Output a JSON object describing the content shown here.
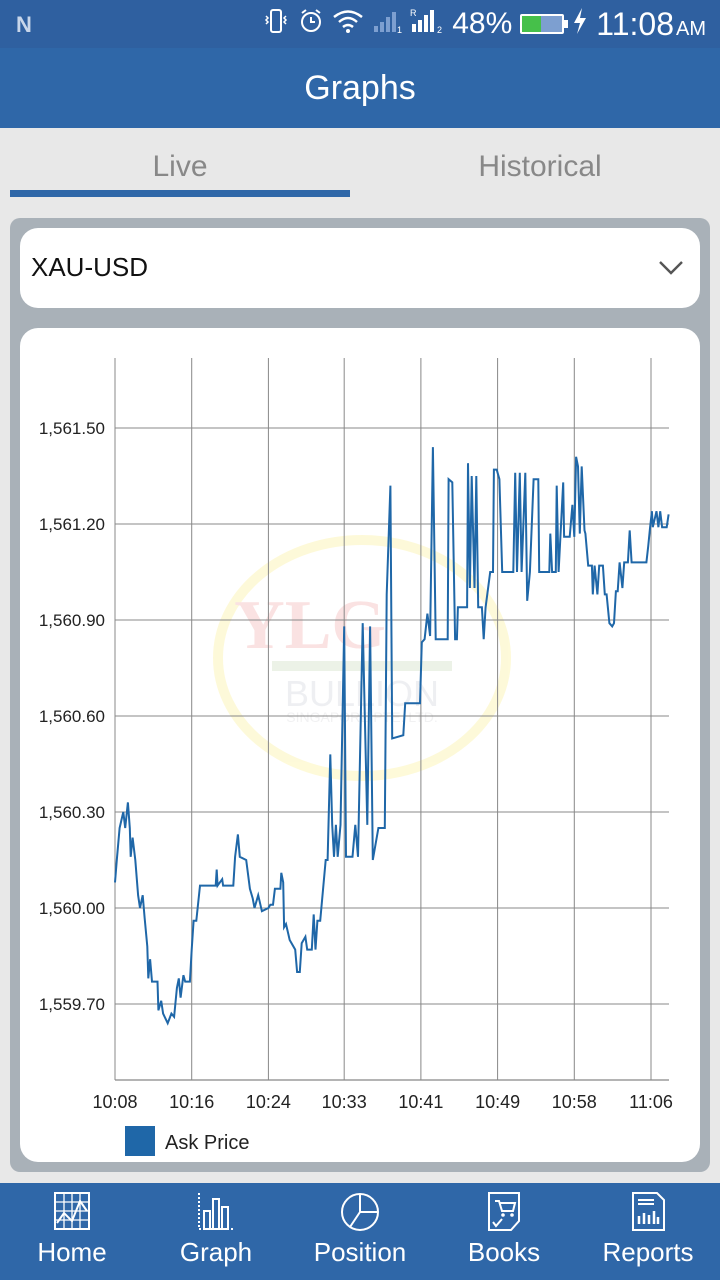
{
  "statusbar": {
    "notification_icon": "n-icon",
    "icons": [
      "vibrate-icon",
      "alarm-icon",
      "wifi-icon",
      "signal-sim1-icon",
      "signal-sim2-icon"
    ],
    "battery_percent": "48%",
    "battery_level": 0.48,
    "charging_icon": "lightning-icon",
    "time": "11:08",
    "ampm": "AM"
  },
  "appbar": {
    "title": "Graphs"
  },
  "tabs": [
    {
      "label": "Live",
      "active": true
    },
    {
      "label": "Historical",
      "active": false
    }
  ],
  "selector": {
    "value": "XAU-USD",
    "icon": "chevron-down-icon"
  },
  "watermark": {
    "line1": "YLG",
    "line2": "BULLION",
    "line3": "SINGAPORE PTE. LTD."
  },
  "colors": {
    "primary": "#2f67a8",
    "line": "#1f67a8",
    "grid": "#888888"
  },
  "chart_data": {
    "type": "line",
    "title": "",
    "xlabel": "",
    "ylabel": "",
    "x_unit": "minutes after 10:08",
    "xlim": [
      0,
      60
    ],
    "ylim": [
      1559.45,
      1561.72
    ],
    "yticks": [
      1559.7,
      1560.0,
      1560.3,
      1560.6,
      1560.9,
      1561.2,
      1561.5
    ],
    "ytick_labels": [
      "1,559.70",
      "1,560.00",
      "1,560.30",
      "1,560.60",
      "1,560.90",
      "1,561.20",
      "1,561.50"
    ],
    "xticks": [
      0,
      8.3,
      16.6,
      24.8,
      33.1,
      41.4,
      49.7,
      58
    ],
    "xtick_labels": [
      "10:08",
      "10:16",
      "10:24",
      "10:33",
      "10:41",
      "10:49",
      "10:58",
      "11:06"
    ],
    "grid": true,
    "legend": {
      "position": "bottom-left",
      "entries": [
        {
          "label": "Ask Price",
          "color": "#1f67a8"
        }
      ]
    },
    "series": [
      {
        "name": "Ask Price",
        "points": [
          [
            0.0,
            1560.08
          ],
          [
            0.2,
            1560.15
          ],
          [
            0.5,
            1560.25
          ],
          [
            0.9,
            1560.3
          ],
          [
            1.1,
            1560.25
          ],
          [
            1.4,
            1560.33
          ],
          [
            1.6,
            1560.25
          ],
          [
            1.7,
            1560.16
          ],
          [
            1.9,
            1560.22
          ],
          [
            2.2,
            1560.15
          ],
          [
            2.5,
            1560.04
          ],
          [
            2.7,
            1560.0
          ],
          [
            3.0,
            1560.04
          ],
          [
            3.2,
            1559.97
          ],
          [
            3.5,
            1559.88
          ],
          [
            3.6,
            1559.78
          ],
          [
            3.8,
            1559.84
          ],
          [
            4.0,
            1559.77
          ],
          [
            4.6,
            1559.77
          ],
          [
            4.7,
            1559.68
          ],
          [
            5.0,
            1559.71
          ],
          [
            5.2,
            1559.67
          ],
          [
            5.7,
            1559.64
          ],
          [
            6.1,
            1559.67
          ],
          [
            6.4,
            1559.66
          ],
          [
            6.7,
            1559.75
          ],
          [
            6.9,
            1559.78
          ],
          [
            7.1,
            1559.72
          ],
          [
            7.4,
            1559.79
          ],
          [
            7.6,
            1559.77
          ],
          [
            8.1,
            1559.77
          ],
          [
            8.3,
            1559.87
          ],
          [
            8.5,
            1559.96
          ],
          [
            8.8,
            1559.96
          ],
          [
            9.2,
            1560.07
          ],
          [
            10.9,
            1560.07
          ],
          [
            11.0,
            1560.12
          ],
          [
            11.1,
            1560.07
          ],
          [
            11.6,
            1560.09
          ],
          [
            11.7,
            1560.07
          ],
          [
            12.8,
            1560.07
          ],
          [
            13.0,
            1560.16
          ],
          [
            13.3,
            1560.23
          ],
          [
            13.5,
            1560.16
          ],
          [
            14.2,
            1560.15
          ],
          [
            14.6,
            1560.06
          ],
          [
            14.9,
            1560.03
          ],
          [
            15.1,
            1560.0
          ],
          [
            15.5,
            1560.04
          ],
          [
            15.9,
            1559.99
          ],
          [
            16.6,
            1560.0
          ],
          [
            16.8,
            1560.01
          ],
          [
            17.1,
            1560.01
          ],
          [
            17.3,
            1560.06
          ],
          [
            17.9,
            1560.06
          ],
          [
            18.0,
            1560.11
          ],
          [
            18.2,
            1560.08
          ],
          [
            18.3,
            1559.94
          ],
          [
            18.5,
            1559.95
          ],
          [
            18.9,
            1559.9
          ],
          [
            19.5,
            1559.87
          ],
          [
            19.7,
            1559.8
          ],
          [
            20.0,
            1559.8
          ],
          [
            20.2,
            1559.89
          ],
          [
            20.6,
            1559.91
          ],
          [
            20.8,
            1559.87
          ],
          [
            21.1,
            1559.87
          ],
          [
            21.3,
            1559.87
          ],
          [
            21.5,
            1559.98
          ],
          [
            21.7,
            1559.87
          ],
          [
            21.9,
            1559.96
          ],
          [
            22.2,
            1559.96
          ],
          [
            22.8,
            1560.15
          ],
          [
            23.0,
            1560.15
          ],
          [
            23.3,
            1560.48
          ],
          [
            23.5,
            1560.26
          ],
          [
            23.7,
            1560.16
          ],
          [
            23.9,
            1560.26
          ],
          [
            24.1,
            1560.16
          ],
          [
            24.4,
            1560.26
          ],
          [
            24.8,
            1560.88
          ],
          [
            25.0,
            1560.16
          ],
          [
            25.7,
            1560.16
          ],
          [
            26.0,
            1560.26
          ],
          [
            26.3,
            1560.16
          ],
          [
            26.8,
            1560.89
          ],
          [
            27.3,
            1560.26
          ],
          [
            27.6,
            1560.88
          ],
          [
            27.9,
            1560.15
          ],
          [
            28.5,
            1560.25
          ],
          [
            29.2,
            1560.25
          ],
          [
            29.4,
            1560.98
          ],
          [
            29.8,
            1561.32
          ],
          [
            30.0,
            1560.53
          ],
          [
            31.2,
            1560.54
          ],
          [
            31.4,
            1560.64
          ],
          [
            33.0,
            1560.64
          ],
          [
            33.2,
            1560.83
          ],
          [
            33.5,
            1560.84
          ],
          [
            33.8,
            1560.92
          ],
          [
            34.1,
            1560.85
          ],
          [
            34.4,
            1561.44
          ],
          [
            34.7,
            1560.84
          ],
          [
            36.0,
            1560.84
          ],
          [
            36.1,
            1561.34
          ],
          [
            36.5,
            1561.33
          ],
          [
            36.8,
            1560.84
          ],
          [
            37.0,
            1560.84
          ],
          [
            37.1,
            1560.94
          ],
          [
            38.1,
            1560.94
          ],
          [
            38.2,
            1561.39
          ],
          [
            38.4,
            1561.0
          ],
          [
            38.6,
            1561.35
          ],
          [
            38.9,
            1561.0
          ],
          [
            39.1,
            1561.35
          ],
          [
            39.3,
            1560.94
          ],
          [
            39.7,
            1560.94
          ],
          [
            39.9,
            1560.84
          ],
          [
            40.1,
            1560.94
          ],
          [
            40.6,
            1561.05
          ],
          [
            40.9,
            1561.05
          ],
          [
            41.0,
            1561.37
          ],
          [
            41.3,
            1561.37
          ],
          [
            41.6,
            1561.34
          ],
          [
            41.9,
            1561.05
          ],
          [
            43.1,
            1561.05
          ],
          [
            43.3,
            1561.36
          ],
          [
            43.5,
            1561.05
          ],
          [
            43.8,
            1561.36
          ],
          [
            44.0,
            1561.05
          ],
          [
            44.4,
            1561.36
          ],
          [
            44.6,
            1560.96
          ],
          [
            44.9,
            1561.05
          ],
          [
            45.3,
            1561.34
          ],
          [
            45.8,
            1561.34
          ],
          [
            45.9,
            1561.05
          ],
          [
            47.0,
            1561.05
          ],
          [
            47.1,
            1561.17
          ],
          [
            47.3,
            1561.05
          ],
          [
            47.7,
            1561.05
          ],
          [
            47.8,
            1561.32
          ],
          [
            48.0,
            1561.05
          ],
          [
            48.5,
            1561.33
          ],
          [
            48.6,
            1561.16
          ],
          [
            49.2,
            1561.16
          ],
          [
            49.5,
            1561.26
          ],
          [
            49.7,
            1561.16
          ],
          [
            49.9,
            1561.41
          ],
          [
            50.1,
            1561.38
          ],
          [
            50.3,
            1561.17
          ],
          [
            50.5,
            1561.38
          ],
          [
            50.8,
            1561.18
          ],
          [
            50.9,
            1561.17
          ],
          [
            51.2,
            1561.07
          ],
          [
            51.6,
            1561.07
          ],
          [
            51.7,
            1560.98
          ],
          [
            51.9,
            1561.07
          ],
          [
            52.2,
            1560.98
          ],
          [
            52.4,
            1561.07
          ],
          [
            52.8,
            1561.07
          ],
          [
            53.0,
            1560.98
          ],
          [
            53.2,
            1560.98
          ],
          [
            53.5,
            1560.89
          ],
          [
            53.8,
            1560.88
          ],
          [
            54.0,
            1560.89
          ],
          [
            54.2,
            1560.99
          ],
          [
            54.4,
            1560.99
          ],
          [
            54.6,
            1561.08
          ],
          [
            54.9,
            1561.0
          ],
          [
            55.1,
            1561.08
          ],
          [
            55.5,
            1561.08
          ],
          [
            55.7,
            1561.18
          ],
          [
            55.9,
            1561.08
          ],
          [
            57.5,
            1561.08
          ],
          [
            57.7,
            1561.13
          ],
          [
            57.9,
            1561.19
          ],
          [
            58.1,
            1561.24
          ],
          [
            58.2,
            1561.19
          ],
          [
            58.6,
            1561.24
          ],
          [
            58.8,
            1561.19
          ],
          [
            59.0,
            1561.24
          ],
          [
            59.2,
            1561.19
          ],
          [
            59.7,
            1561.19
          ],
          [
            59.9,
            1561.23
          ]
        ]
      }
    ]
  },
  "bottomnav": [
    {
      "label": "Home",
      "icon": "home-grid-chart-icon"
    },
    {
      "label": "Graph",
      "icon": "bar-graph-icon"
    },
    {
      "label": "Position",
      "icon": "pie-chart-icon"
    },
    {
      "label": "Books",
      "icon": "cart-book-icon"
    },
    {
      "label": "Reports",
      "icon": "report-doc-icon"
    }
  ]
}
